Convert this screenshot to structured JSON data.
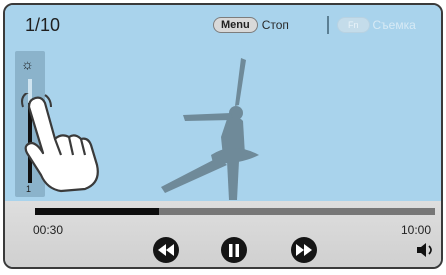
{
  "status": {
    "counter": "1/10"
  },
  "menu_bar": {
    "menu_key": "Menu",
    "menu_label": "Стоп",
    "fn_key": "Fn",
    "fn_label": "Съемка"
  },
  "brightness": {
    "level_label": "1",
    "level_fraction": 0.77,
    "icon": "sun-icon"
  },
  "playback": {
    "elapsed": "00:30",
    "total": "10:00",
    "progress_fraction": 0.31
  },
  "icons": [
    "rewind-icon",
    "pause-icon",
    "fast-forward-icon",
    "volume-icon",
    "hand-gesture-icon"
  ],
  "colors": {
    "viewer_bg": "#a9d3ec",
    "silhouette": "#6f8a99",
    "control_bg": "#d8d8d8"
  }
}
